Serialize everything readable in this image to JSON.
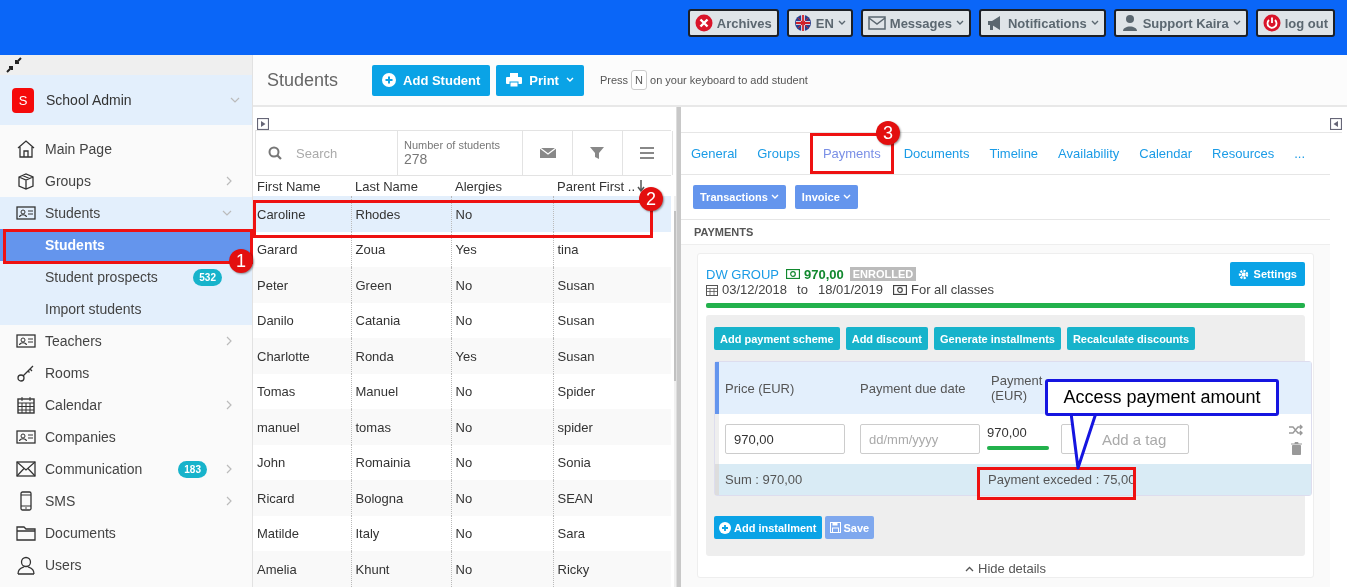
{
  "topbar": {
    "buttons": [
      {
        "label": "Archives",
        "dropdown": false
      },
      {
        "label": "EN",
        "dropdown": true
      },
      {
        "label": "Messages",
        "dropdown": true
      },
      {
        "label": "Notifications",
        "dropdown": true
      },
      {
        "label": "Support Kaira",
        "dropdown": true
      },
      {
        "label": "log out",
        "dropdown": false
      }
    ]
  },
  "sidebar": {
    "account": {
      "initial": "S",
      "name": "School Admin"
    },
    "items": [
      {
        "label": "Main Page",
        "kind": "link"
      },
      {
        "label": "Groups",
        "kind": "group",
        "expanded": false
      },
      {
        "label": "Students",
        "kind": "group",
        "expanded": true,
        "children": [
          {
            "label": "Students",
            "selected": true
          },
          {
            "label": "Student prospects",
            "badge": "532",
            "selected": false
          },
          {
            "label": "Import students",
            "selected": false
          }
        ]
      },
      {
        "label": "Teachers",
        "kind": "group",
        "expanded": false
      },
      {
        "label": "Rooms",
        "kind": "link"
      },
      {
        "label": "Calendar",
        "kind": "group",
        "expanded": false
      },
      {
        "label": "Companies",
        "kind": "link"
      },
      {
        "label": "Communication",
        "kind": "group",
        "expanded": false,
        "badge": "183"
      },
      {
        "label": "SMS",
        "kind": "group",
        "expanded": false
      },
      {
        "label": "Documents",
        "kind": "link"
      },
      {
        "label": "Users",
        "kind": "link"
      }
    ]
  },
  "students": {
    "title": "Students",
    "add_button": "Add Student",
    "print_button": "Print",
    "hint": {
      "before": "Press",
      "key": "N",
      "after": "on your keyboard to add student"
    },
    "search": {
      "placeholder": "Search"
    },
    "count": {
      "label": "Number of students",
      "value": "278"
    },
    "columns": [
      "First Name",
      "Last Name",
      "Alergies",
      "Parent First .."
    ],
    "rows": [
      {
        "cells": [
          "Caroline",
          "Rhodes",
          "No"
        ],
        "selected": true
      },
      {
        "cells": [
          "Garard",
          "Zoua",
          "Yes",
          "tina"
        ],
        "selected": false
      },
      {
        "cells": [
          "Peter",
          "Green",
          "No",
          "Susan"
        ],
        "selected": false
      },
      {
        "cells": [
          "Danilo",
          "Catania",
          "No",
          "Susan"
        ],
        "selected": false
      },
      {
        "cells": [
          "Charlotte",
          "Ronda",
          "Yes",
          "Susan"
        ],
        "selected": false
      },
      {
        "cells": [
          "Tomas",
          "Manuel",
          "No",
          "Spider"
        ],
        "selected": false
      },
      {
        "cells": [
          "manuel",
          "tomas",
          "No",
          "spider"
        ],
        "selected": false
      },
      {
        "cells": [
          "John",
          "Romainia",
          "No",
          "Sonia"
        ],
        "selected": false
      },
      {
        "cells": [
          "Ricard",
          "Bologna",
          "No",
          "SEAN"
        ],
        "selected": false
      },
      {
        "cells": [
          "Matilde",
          "Italy",
          "No",
          "Sara"
        ],
        "selected": false
      },
      {
        "cells": [
          "Amelia",
          "Khunt",
          "No",
          "Ricky"
        ],
        "selected": false
      }
    ]
  },
  "details": {
    "tabs": [
      {
        "label": "General",
        "selected": false
      },
      {
        "label": "Groups",
        "selected": false
      },
      {
        "label": "Payments",
        "selected": true
      },
      {
        "label": "Documents",
        "selected": false
      },
      {
        "label": "Timeline",
        "selected": false
      },
      {
        "label": "Availability",
        "selected": false
      },
      {
        "label": "Calendar",
        "selected": false
      },
      {
        "label": "Resources",
        "selected": false
      },
      {
        "label": "...",
        "selected": false
      }
    ],
    "menus": [
      "Transactions",
      "Invoice"
    ],
    "section_title": "PAYMENTS",
    "group": {
      "name": "DW GROUP",
      "amount": "970,00",
      "status": "ENROLLED",
      "settings": "Settings",
      "start": "03/12/2018",
      "to": "to",
      "end": "18/01/2019",
      "scope": "For all classes",
      "level": 1,
      "actions": [
        "Add payment scheme",
        "Add discount",
        "Generate installments",
        "Recalculate discounts"
      ],
      "columns": [
        "Price (EUR)",
        "Payment due date",
        "Payment (EUR)"
      ],
      "installment": {
        "price": "970,00",
        "date_placeholder": "dd/mm/yyyy",
        "payment": "970,00",
        "level": 1,
        "tag_placeholder": "Add a tag"
      },
      "sum": "Sum : 970,00",
      "exceeded": "Payment exceded : 75,00",
      "add_installment": "Add installment",
      "save": {
        "label": "Save",
        "disabled": true
      },
      "hide": "Hide details"
    }
  },
  "annotations": {
    "steps": [
      "1",
      "2",
      "3"
    ],
    "callout": "Access payment amount"
  }
}
